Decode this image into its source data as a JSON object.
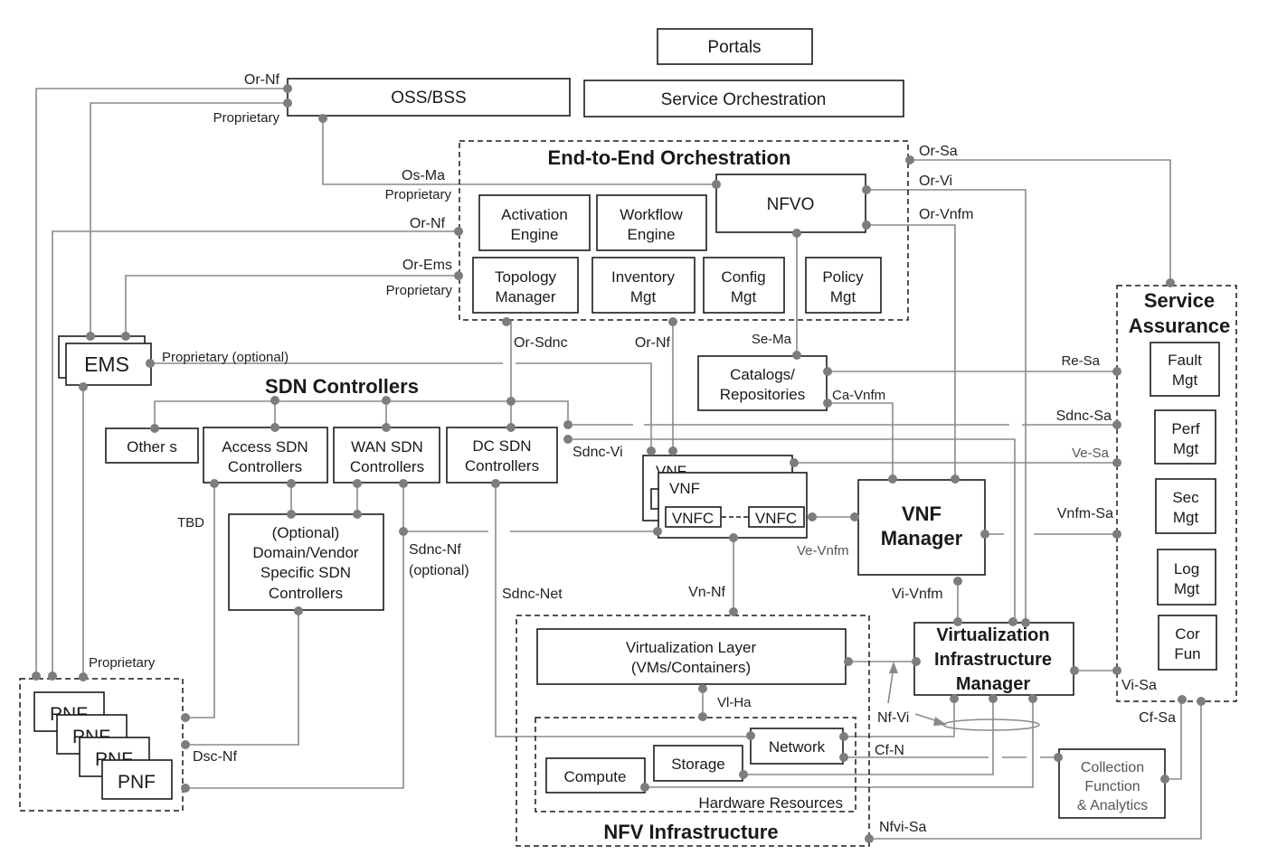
{
  "diagram": {
    "top": {
      "portals": "Portals",
      "oss_bss": "OSS/BSS",
      "service_orchestration": "Service Orchestration"
    },
    "e2e": {
      "title": "End-to-End Orchestration",
      "nfvo": "NFVO",
      "activation": [
        "Activation",
        "Engine"
      ],
      "workflow": [
        "Workflow",
        "Engine"
      ],
      "topology": [
        "Topology",
        "Manager"
      ],
      "inventory": [
        "Inventory",
        "Mgt"
      ],
      "config": [
        "Config",
        "Mgt"
      ],
      "policy": [
        "Policy",
        "Mgt"
      ]
    },
    "ems": "EMS",
    "sdn": {
      "title": "SDN Controllers",
      "others": "Other s",
      "access": [
        "Access SDN",
        "Controllers"
      ],
      "wan": [
        "WAN SDN",
        "Controllers"
      ],
      "dc": [
        "DC SDN",
        "Controllers"
      ],
      "domain": [
        "(Optional)",
        "Domain/Vendor",
        "Specific SDN",
        "Controllers"
      ]
    },
    "catalogs": [
      "Catalogs/",
      "Repositories"
    ],
    "vnf": {
      "back": "VNF",
      "front": "VNF",
      "vnfc1": "VNFC",
      "vnfc2": "VNFC"
    },
    "vnfm": [
      "VNF",
      "Manager"
    ],
    "vim": [
      "Virtualization",
      "Infrastructure",
      "Manager"
    ],
    "nfvi": {
      "title": "NFV Infrastructure",
      "virt_layer": [
        "Virtualization Layer",
        "(VMs/Containers)"
      ],
      "hw_title": "Hardware Resources",
      "network": "Network",
      "storage": "Storage",
      "compute": "Compute"
    },
    "pnf": [
      "PNF",
      "PNF",
      "PNF",
      "PNF"
    ],
    "service_assurance": {
      "title": [
        "Service",
        "Assurance"
      ],
      "fault": [
        "Fault",
        "Mgt"
      ],
      "perf": [
        "Perf",
        "Mgt"
      ],
      "sec": [
        "Sec",
        "Mgt"
      ],
      "log": [
        "Log",
        "Mgt"
      ],
      "cor": [
        "Cor",
        "Fun"
      ]
    },
    "collection": [
      "Collection",
      "Function",
      "& Analytics"
    ],
    "interfaces": {
      "or_nf_top": "Or-Nf",
      "proprietary_top": "Proprietary",
      "os_ma": "Os-Ma",
      "proprietary_osma": "Proprietary",
      "or_nf_mid": "Or-Nf",
      "or_ems": "Or-Ems",
      "proprietary_ems": "Proprietary",
      "proprietary_optional": "Proprietary (optional)",
      "or_sdnc": "Or-Sdnc",
      "or_nf_vnf": "Or-Nf",
      "se_ma": "Se-Ma",
      "ca_vnfm": "Ca-Vnfm",
      "sdnc_vi": "Sdnc-Vi",
      "tbd": "TBD",
      "sdnc_nf": "Sdnc-Nf",
      "sdnc_nf_opt": "(optional)",
      "sdnc_net": "Sdnc-Net",
      "vn_nf": "Vn-Nf",
      "ve_vnfm": "Ve-Vnfm",
      "vi_vnfm": "Vi-Vnfm",
      "vi_ha": "Vl-Ha",
      "nf_vi": "Nf-Vi",
      "cf_n": "Cf-N",
      "nfvi_sa": "Nfvi-Sa",
      "proprietary_pnf": "Proprietary",
      "dsc_nf": "Dsc-Nf",
      "or_sa": "Or-Sa",
      "or_vi": "Or-Vi",
      "or_vnfm": "Or-Vnfm",
      "re_sa": "Re-Sa",
      "sdnc_sa": "Sdnc-Sa",
      "ve_sa": "Ve-Sa",
      "vnfm_sa": "Vnfm-Sa",
      "vi_sa": "Vi-Sa",
      "cf_sa": "Cf-Sa"
    }
  }
}
